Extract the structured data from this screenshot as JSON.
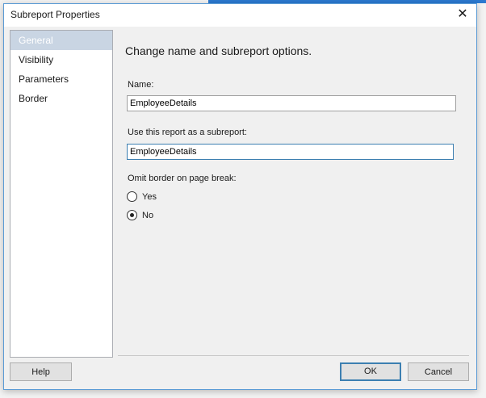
{
  "dialog": {
    "title": "Subreport Properties",
    "close_icon": "close-icon"
  },
  "sidebar": {
    "items": [
      {
        "label": "General",
        "selected": true
      },
      {
        "label": "Visibility"
      },
      {
        "label": "Parameters"
      },
      {
        "label": "Border"
      }
    ]
  },
  "main": {
    "heading": "Change name and subreport options.",
    "name_label": "Name:",
    "name_value": "EmployeeDetails",
    "subreport_label": "Use this report as a subreport:",
    "subreport_value": "EmployeeDetails",
    "omit_label": "Omit border on page break:",
    "options": [
      {
        "label": "Yes",
        "checked": false
      },
      {
        "label": "No",
        "checked": true
      }
    ]
  },
  "buttons": {
    "help": "Help",
    "ok": "OK",
    "cancel": "Cancel"
  }
}
